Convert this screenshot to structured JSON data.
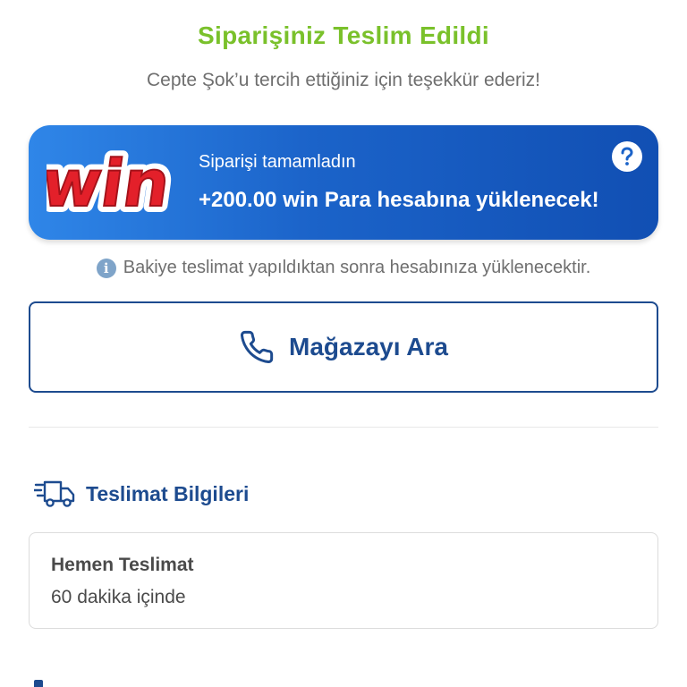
{
  "header": {
    "title": "Siparişiniz Teslim Edildi",
    "subtitle": "Cepte Şok’u tercih ettiğiniz için teşekkür ederiz!"
  },
  "win_banner": {
    "logo_text": "win",
    "line1": "Siparişi tamamladın",
    "line2": "+200.00 win Para hesabına yüklenecek!",
    "help_icon": "question-circle-icon",
    "colors": {
      "start": "#2f86e8",
      "end": "#114fb3",
      "logo_red": "#e3202a"
    }
  },
  "info": {
    "icon": "info-icon",
    "text": "Bakiye teslimat yapıldıktan sonra hesabınıza yüklenecektir."
  },
  "call_store": {
    "icon": "phone-icon",
    "label": "Mağazayı Ara"
  },
  "delivery_section": {
    "icon": "delivery-truck-icon",
    "title": "Teslimat Bilgileri",
    "card": {
      "type": "Hemen Teslimat",
      "time": "60 dakika içinde"
    }
  },
  "colors": {
    "accent_green": "#7ac12b",
    "brand_blue": "#1d4b8f",
    "text_gray": "#6f6f6f"
  }
}
